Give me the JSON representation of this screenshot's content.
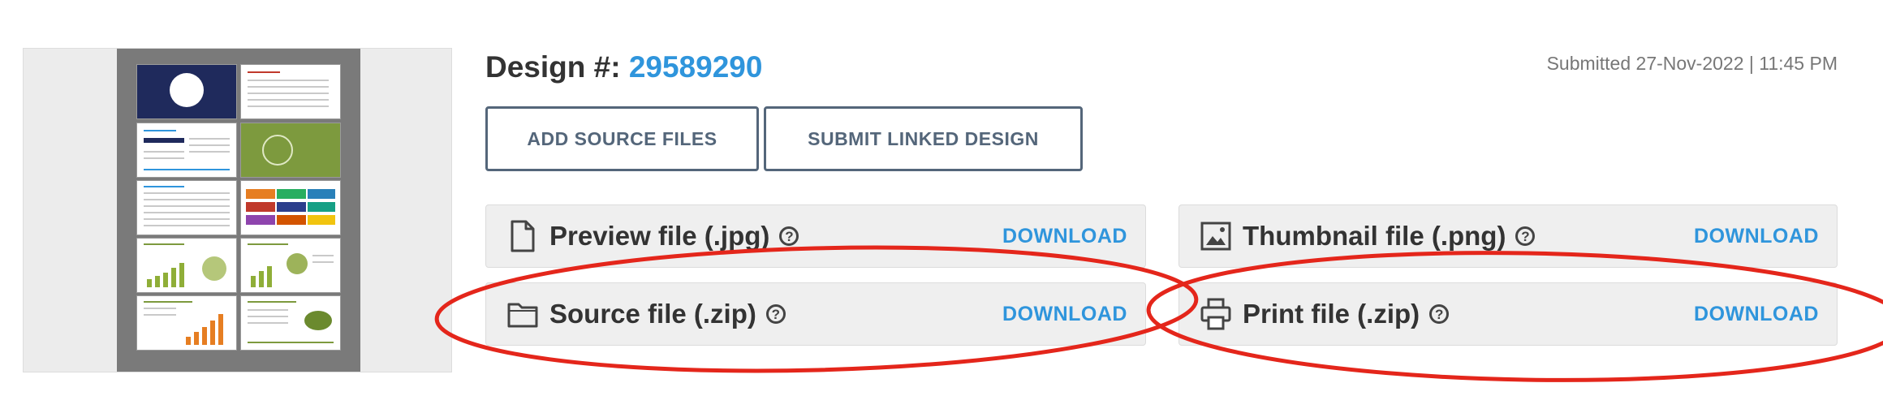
{
  "design": {
    "title_prefix": "Design #:",
    "number": "29589290",
    "submitted": "Submitted 27-Nov-2022 | 11:45 PM"
  },
  "buttons": {
    "add_source": "ADD SOURCE FILES",
    "submit_linked": "SUBMIT LINKED DESIGN"
  },
  "files": [
    {
      "label": "Preview file (.jpg)",
      "icon": "document-icon",
      "help": "?",
      "action": "DOWNLOAD"
    },
    {
      "label": "Thumbnail file (.png)",
      "icon": "image-icon",
      "help": "?",
      "action": "DOWNLOAD"
    },
    {
      "label": "Source file (.zip)",
      "icon": "folder-icon",
      "help": "?",
      "action": "DOWNLOAD"
    },
    {
      "label": "Print file (.zip)",
      "icon": "printer-icon",
      "help": "?",
      "action": "DOWNLOAD"
    }
  ],
  "colors": {
    "accent": "#2f95dc",
    "button_border": "#54667a",
    "row_bg": "#efefef",
    "annotation": "#e4261b"
  }
}
